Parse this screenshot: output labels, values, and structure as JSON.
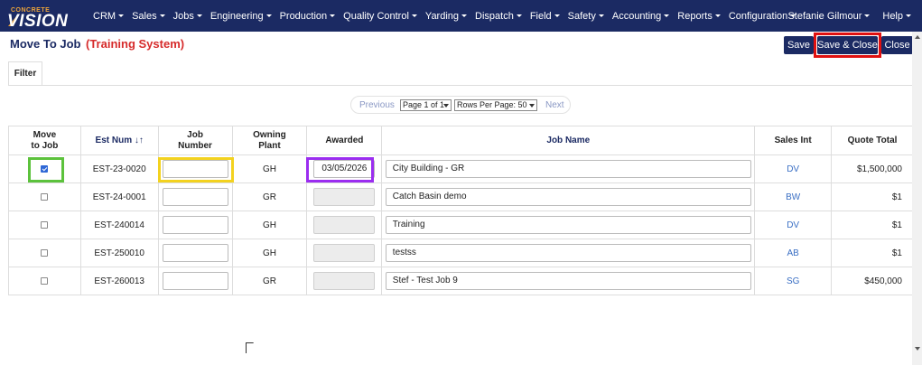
{
  "logo": {
    "line1": "CONCRETE",
    "line2": "VISION"
  },
  "nav": {
    "items": [
      "CRM",
      "Sales",
      "Jobs",
      "Engineering",
      "Production",
      "Quality Control",
      "Yarding",
      "Dispatch",
      "Field",
      "Safety",
      "Accounting",
      "Reports",
      "Configuration"
    ],
    "user": "Stefanie Gilmour",
    "help": "Help"
  },
  "page": {
    "title": "Move To Job",
    "system_label": "(Training System)"
  },
  "toolbar": {
    "save_label": "Save",
    "save_close_label": "Save & Close",
    "close_label": "Close"
  },
  "tabs": {
    "filter_label": "Filter"
  },
  "pager": {
    "prev": "Previous",
    "next": "Next",
    "page_select": "Page 1 of 1",
    "rows_select": "Rows Per Page: 50"
  },
  "table": {
    "headers": {
      "move": "Move to Job",
      "est_num": "Est Num",
      "job_number": "Job Number",
      "owning_plant": "Owning Plant",
      "awarded": "Awarded",
      "job_name": "Job Name",
      "sales_int": "Sales Int",
      "quote_total": "Quote Total"
    },
    "sort_icon": "sort-ascending-icon",
    "rows": [
      {
        "checked": true,
        "est_num": "EST-23-0020",
        "job_number": "",
        "plant": "GH",
        "awarded": "03/05/2026",
        "job_name": "City Building - GR",
        "sales_int": "DV",
        "quote_total": "$1,500,000"
      },
      {
        "checked": false,
        "est_num": "EST-24-0001",
        "job_number": "",
        "plant": "GR",
        "awarded": "",
        "job_name": "Catch Basin demo",
        "sales_int": "BW",
        "quote_total": "$1"
      },
      {
        "checked": false,
        "est_num": "EST-240014",
        "job_number": "",
        "plant": "GH",
        "awarded": "",
        "job_name": "Training",
        "sales_int": "DV",
        "quote_total": "$1"
      },
      {
        "checked": false,
        "est_num": "EST-250010",
        "job_number": "",
        "plant": "GH",
        "awarded": "",
        "job_name": "testss",
        "sales_int": "AB",
        "quote_total": "$1"
      },
      {
        "checked": false,
        "est_num": "EST-260013",
        "job_number": "",
        "plant": "GR",
        "awarded": "",
        "job_name": "Stef - Test Job 9",
        "sales_int": "SG",
        "quote_total": "$450,000"
      }
    ]
  },
  "colors": {
    "navbar": "#1b2a63",
    "brand_orange": "#e9a23b",
    "training_red": "#d62b2b",
    "highlight_red": "#e01010",
    "highlight_green": "#5cc23c",
    "highlight_yellow": "#f3d21f",
    "highlight_purple": "#9b2df0"
  }
}
